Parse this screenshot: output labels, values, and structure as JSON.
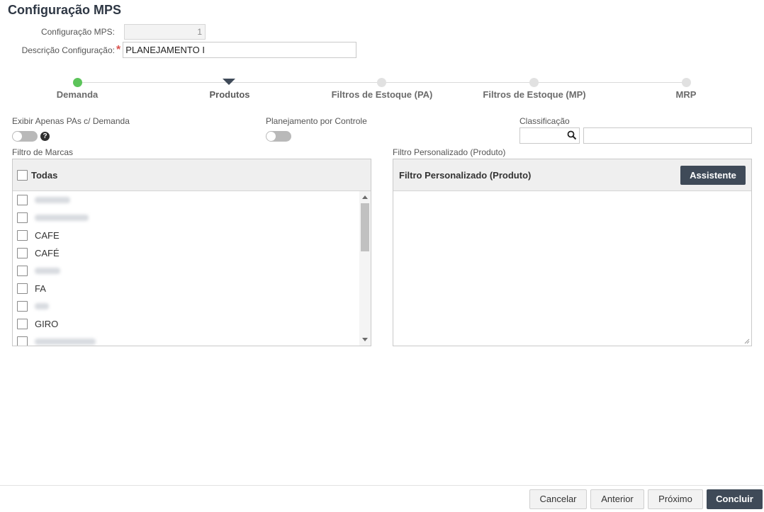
{
  "page": {
    "title": "Configuração MPS"
  },
  "form": {
    "config_label": "Configuração MPS:",
    "config_value": "1",
    "desc_label": "Descrição Configuração:",
    "required_mark": "*",
    "desc_value": "PLANEJAMENTO I"
  },
  "steps": [
    {
      "label": "Demanda",
      "state": "done"
    },
    {
      "label": "Produtos",
      "state": "current"
    },
    {
      "label": "Filtros de Estoque (PA)",
      "state": "pending"
    },
    {
      "label": "Filtros de Estoque (MP)",
      "state": "pending"
    },
    {
      "label": "MRP",
      "state": "pending"
    }
  ],
  "options": {
    "demand_only_label": "Exibir Apenas PAs c/ Demanda",
    "control_planning_label": "Planejamento por Controle",
    "classification_label": "Classificação",
    "help_glyph": "?"
  },
  "brand_filter": {
    "section_label": "Filtro de Marcas",
    "all_label": "Todas",
    "items": [
      {
        "label": "",
        "blurred": true
      },
      {
        "label": "",
        "blurred": true
      },
      {
        "label": "CAFE",
        "blurred": false
      },
      {
        "label": "CAFÉ",
        "blurred": false
      },
      {
        "label": "",
        "blurred": true
      },
      {
        "label": "FA",
        "blurred": false
      },
      {
        "label": "",
        "blurred": true
      },
      {
        "label": "GIRO",
        "blurred": false
      },
      {
        "label": "",
        "blurred": true
      }
    ]
  },
  "custom_filter": {
    "section_label": "Filtro Personalizado (Produto)",
    "panel_title": "Filtro Personalizado (Produto)",
    "assistant_button": "Assistente"
  },
  "footer": {
    "cancel": "Cancelar",
    "previous": "Anterior",
    "next": "Próximo",
    "finish": "Concluir"
  },
  "colors": {
    "accent_dark": "#3f4a58",
    "step_done": "#5cc45a",
    "required": "#d9534f"
  }
}
